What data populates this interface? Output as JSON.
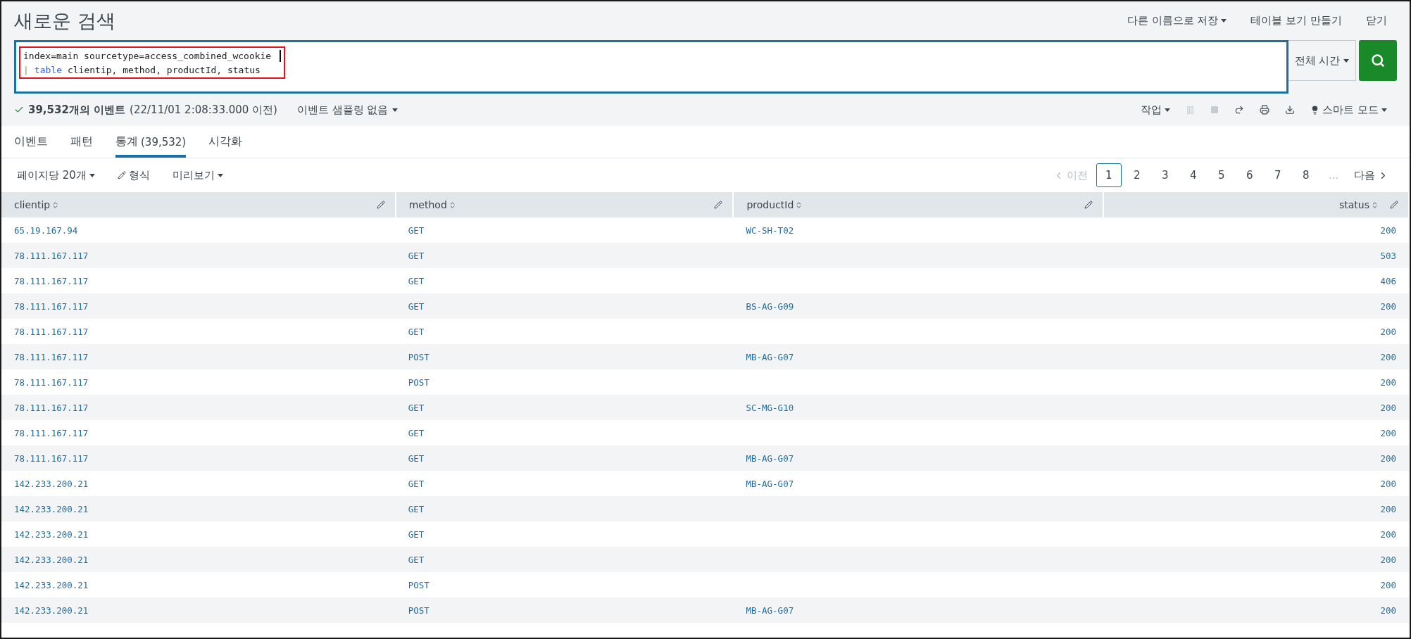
{
  "title": "새로운 검색",
  "header_actions": [
    {
      "label": "다른 이름으로 저장",
      "caret": true
    },
    {
      "label": "테이블 보기 만들기",
      "caret": false
    },
    {
      "label": "닫기",
      "caret": false
    }
  ],
  "search": {
    "lines": [
      [
        {
          "kind": "plain",
          "text": "index=main sourcetype=access_combined_wcookie"
        }
      ],
      [
        {
          "kind": "pipe",
          "text": "|"
        },
        {
          "kind": "command",
          "text": "table"
        },
        {
          "kind": "plain",
          "text": "clientip, method, productId, status"
        }
      ]
    ],
    "time_picker": "전체 시간"
  },
  "job_status": {
    "count": "39,532개의 이벤트",
    "detail": "(22/11/01 2:08:33.000 이전)",
    "sampling": "이벤트 샘플링 없음"
  },
  "job_controls": {
    "job": "작업",
    "mode": "스마트 모드"
  },
  "tabs": [
    {
      "label": "이벤트",
      "selected": false
    },
    {
      "label": "패턴",
      "selected": false
    },
    {
      "label": "통계",
      "count": "(39,532)",
      "selected": true
    },
    {
      "label": "시각화",
      "selected": false
    }
  ],
  "results_toolbar": {
    "per_page": "페이지당 20개",
    "format": "형식",
    "preview": "미리보기"
  },
  "pagination": {
    "prev": "이전",
    "prev_disabled": true,
    "pages": [
      {
        "label": "1",
        "selected": true
      },
      {
        "label": "2",
        "selected": false
      },
      {
        "label": "3",
        "selected": false
      },
      {
        "label": "4",
        "selected": false
      },
      {
        "label": "5",
        "selected": false
      },
      {
        "label": "6",
        "selected": false
      },
      {
        "label": "7",
        "selected": false
      },
      {
        "label": "8",
        "selected": false
      }
    ],
    "ellipsis": "...",
    "next": "다음"
  },
  "table": {
    "columns": [
      "clientip",
      "method",
      "productId",
      "status"
    ],
    "rows": [
      [
        "65.19.167.94",
        "GET",
        "WC-SH-T02",
        "200"
      ],
      [
        "78.111.167.117",
        "GET",
        "",
        "503"
      ],
      [
        "78.111.167.117",
        "GET",
        "",
        "406"
      ],
      [
        "78.111.167.117",
        "GET",
        "BS-AG-G09",
        "200"
      ],
      [
        "78.111.167.117",
        "GET",
        "",
        "200"
      ],
      [
        "78.111.167.117",
        "POST",
        "MB-AG-G07",
        "200"
      ],
      [
        "78.111.167.117",
        "POST",
        "",
        "200"
      ],
      [
        "78.111.167.117",
        "GET",
        "SC-MG-G10",
        "200"
      ],
      [
        "78.111.167.117",
        "GET",
        "",
        "200"
      ],
      [
        "78.111.167.117",
        "GET",
        "MB-AG-G07",
        "200"
      ],
      [
        "142.233.200.21",
        "GET",
        "MB-AG-G07",
        "200"
      ],
      [
        "142.233.200.21",
        "GET",
        "",
        "200"
      ],
      [
        "142.233.200.21",
        "GET",
        "",
        "200"
      ],
      [
        "142.233.200.21",
        "GET",
        "",
        "200"
      ],
      [
        "142.233.200.21",
        "POST",
        "",
        "200"
      ],
      [
        "142.233.200.21",
        "POST",
        "MB-AG-G07",
        "200"
      ]
    ]
  }
}
